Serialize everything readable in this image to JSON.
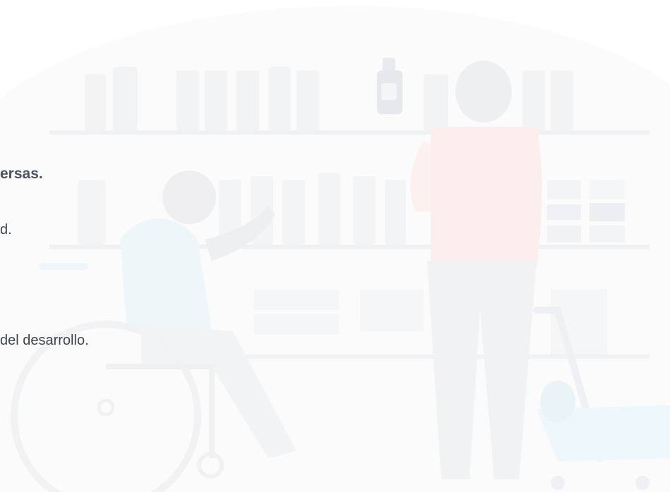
{
  "section": {
    "heading_fragment": "ersas.",
    "body_fragment_1": "d.",
    "body_fragment_2": " del desarrollo."
  },
  "illustration": {
    "subject": "pharmacy-scene",
    "colors": {
      "background_blob": "#fafbfc",
      "shelf": "#eef0f2",
      "bottle": "#eceef1",
      "person_shirt": "#fdeeee",
      "person_skin": "#e9ebee",
      "wheelchair_user_shirt": "#eef6fa",
      "cart": "#eef7fb",
      "text": "#3d4450"
    }
  }
}
